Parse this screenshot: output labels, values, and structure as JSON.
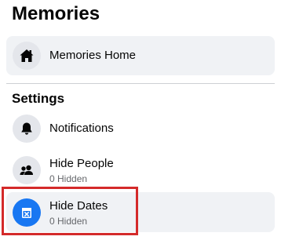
{
  "page_title": "Memories",
  "memories_home": {
    "label": "Memories Home",
    "icon": "home-icon"
  },
  "settings": {
    "section_title": "Settings",
    "items": [
      {
        "label": "Notifications",
        "icon": "bell-icon"
      },
      {
        "label": "Hide People",
        "sub": "0 Hidden",
        "icon": "people-icon"
      },
      {
        "label": "Hide Dates",
        "sub": "0 Hidden",
        "icon": "calendar-hide-icon",
        "selected": true
      }
    ]
  },
  "colors": {
    "accent": "#1877f2",
    "selected_background": "#f0f2f5",
    "highlight_border": "#d42a2a",
    "secondary_text": "#65676b"
  }
}
